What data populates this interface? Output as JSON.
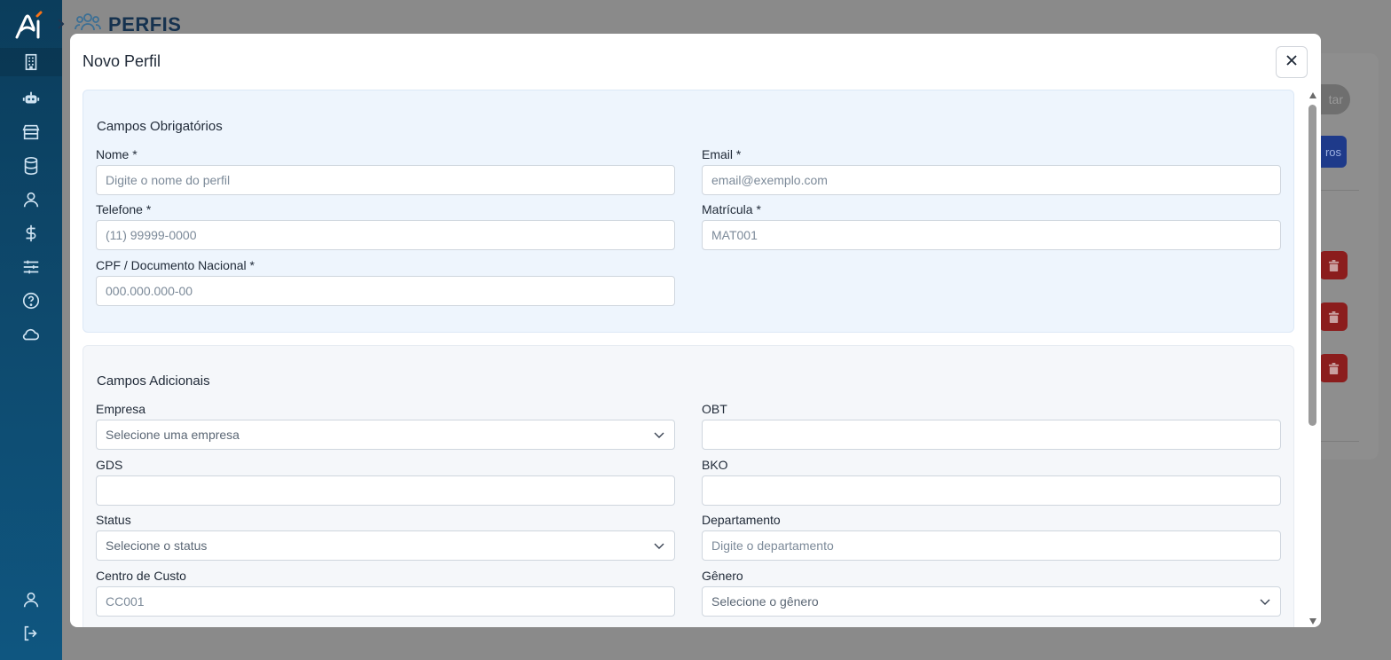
{
  "background": {
    "page_title": "PERFIS",
    "pill_label": "tar",
    "blue_button_label": "ros"
  },
  "sidebar": {
    "items": [
      {
        "icon": "building-icon"
      },
      {
        "icon": "robot-icon"
      },
      {
        "icon": "store-icon"
      },
      {
        "icon": "database-icon"
      },
      {
        "icon": "user-icon"
      },
      {
        "icon": "dollar-icon"
      },
      {
        "icon": "sliders-icon"
      },
      {
        "icon": "help-icon"
      },
      {
        "icon": "cloud-icon"
      }
    ],
    "bottom": [
      {
        "icon": "profile-icon"
      },
      {
        "icon": "logout-icon"
      }
    ]
  },
  "modal": {
    "title": "Novo Perfil",
    "required_section": {
      "title": "Campos Obrigatórios",
      "nome": {
        "label": "Nome *",
        "placeholder": "Digite o nome do perfil"
      },
      "email": {
        "label": "Email *",
        "placeholder": "email@exemplo.com"
      },
      "telefone": {
        "label": "Telefone *",
        "placeholder": "(11) 99999-0000"
      },
      "matricula": {
        "label": "Matrícula *",
        "placeholder": "MAT001"
      },
      "cpf": {
        "label": "CPF / Documento Nacional *",
        "placeholder": "000.000.000-00"
      }
    },
    "additional_section": {
      "title": "Campos Adicionais",
      "empresa": {
        "label": "Empresa",
        "value": "Selecione uma empresa"
      },
      "obt": {
        "label": "OBT",
        "value": ""
      },
      "gds": {
        "label": "GDS",
        "value": ""
      },
      "bko": {
        "label": "BKO",
        "value": ""
      },
      "status": {
        "label": "Status",
        "value": "Selecione o status"
      },
      "departamento": {
        "label": "Departamento",
        "placeholder": "Digite o departamento"
      },
      "centro_custo": {
        "label": "Centro de Custo",
        "placeholder": "CC001"
      },
      "genero": {
        "label": "Gênero",
        "value": "Selecione o gênero"
      }
    }
  },
  "colors": {
    "sidebar_top": "#0b3d5c",
    "sidebar_bottom": "#0f5680",
    "required_bg": "#eef5fd",
    "additional_bg": "#f5f7fa",
    "logo_accent": "#f97316"
  }
}
